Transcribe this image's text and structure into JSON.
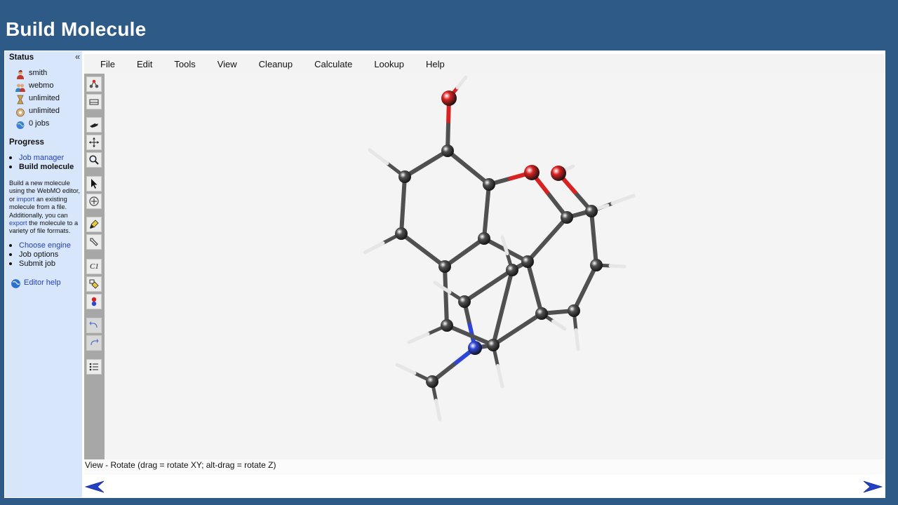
{
  "header": {
    "title": "Build Molecule"
  },
  "sidebar": {
    "collapse_glyph": "«",
    "status_heading": "Status",
    "status_items": [
      {
        "icon": "user-icon",
        "label": "smith"
      },
      {
        "icon": "group-icon",
        "label": "webmo"
      },
      {
        "icon": "time-icon",
        "label": "unlimited"
      },
      {
        "icon": "storage-icon",
        "label": "unlimited"
      },
      {
        "icon": "jobs-globe-icon",
        "label": "0 jobs"
      }
    ],
    "progress_heading": "Progress",
    "progress_items": [
      {
        "label": "Job manager",
        "link": true
      },
      {
        "label": "Build molecule",
        "current": true
      }
    ],
    "description": {
      "part1": "Build a new molecule using the WebMO editor, or ",
      "link1": "import",
      "part2": " an existing molecule from a file. Additionally, you can ",
      "link2": "export",
      "part3": " the molecule to a variety of file formats."
    },
    "next_steps": [
      {
        "label": "Choose engine",
        "link": true
      },
      {
        "label": "Job options"
      },
      {
        "label": "Submit job"
      }
    ],
    "help_link": "Editor help"
  },
  "menu": [
    "File",
    "Edit",
    "Tools",
    "View",
    "Cleanup",
    "Calculate",
    "Lookup",
    "Help"
  ],
  "toolbar": [
    {
      "name": "build-tool-icon"
    },
    {
      "name": "template-tool-icon"
    },
    {
      "name": "rotate-view-icon"
    },
    {
      "name": "translate-view-icon"
    },
    {
      "name": "zoom-view-icon"
    },
    {
      "name": "select-pointer-icon"
    },
    {
      "name": "add-atom-icon"
    },
    {
      "name": "cleanup-brush-icon"
    },
    {
      "name": "adjust-wrench-icon"
    },
    {
      "name": "symmetry-c1-icon",
      "label": "C1"
    },
    {
      "name": "comprehensive-cleanup-icon"
    },
    {
      "name": "charge-icon"
    },
    {
      "name": "undo-icon"
    },
    {
      "name": "redo-icon"
    },
    {
      "name": "list-icon"
    }
  ],
  "status_line": "View - Rotate (drag = rotate XY; alt-drag = rotate Z)",
  "colors": {
    "header_bg": "#2d5a86",
    "sidebar_bg": "#d7e6fa",
    "link": "#2342b8",
    "carbon": "#505050",
    "oxygen": "#d82222",
    "nitrogen": "#2f45d8",
    "hydrogen": "#f0f0f0"
  }
}
